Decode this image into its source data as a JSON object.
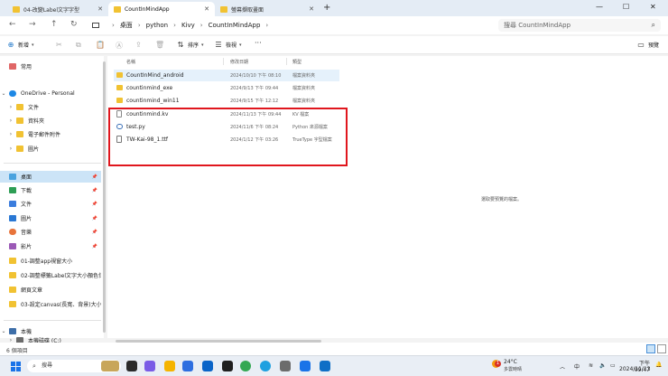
{
  "tabs": [
    {
      "label": "04-改變Label文字字型"
    },
    {
      "label": "CountInMindApp"
    },
    {
      "label": "螢幕擷取畫面"
    }
  ],
  "window_controls": {
    "minimize": "—",
    "maximize": "☐",
    "close": "✕"
  },
  "nav": {
    "back": "←",
    "forward": "→",
    "up": "↑",
    "refresh": "↻"
  },
  "breadcrumb": [
    "桌面",
    "python",
    "Kivy",
    "CountInMindApp"
  ],
  "search": {
    "placeholder": "搜尋 CountInMindApp"
  },
  "toolbar": {
    "new_label": "新增",
    "sort_label": "排序",
    "view_label": "檢視",
    "more_label": "···",
    "preview_label": "預覽"
  },
  "sidebar": {
    "items": [
      {
        "label": "常用",
        "icon": "home-icon"
      },
      {
        "label": "OneDrive - Personal",
        "icon": "cloud-icon"
      },
      {
        "label": "文件",
        "icon": "folder-icon"
      },
      {
        "label": "資料夾",
        "icon": "folder-icon"
      },
      {
        "label": "電子郵件附件",
        "icon": "folder-icon"
      },
      {
        "label": "圖片",
        "icon": "folder-icon"
      },
      {
        "label": "桌面",
        "icon": "desktop-icon"
      },
      {
        "label": "下載",
        "icon": "download-icon"
      },
      {
        "label": "文件",
        "icon": "documents-icon"
      },
      {
        "label": "圖片",
        "icon": "pictures-icon"
      },
      {
        "label": "音樂",
        "icon": "music-icon"
      },
      {
        "label": "影片",
        "icon": "videos-icon"
      },
      {
        "label": "01-調整app視窗大小",
        "icon": "folder-icon"
      },
      {
        "label": "02-調整標籤Label文字大小顏色位",
        "icon": "folder-icon"
      },
      {
        "label": "網頁文章",
        "icon": "folder-icon"
      },
      {
        "label": "03-設定canvas(長寬、背景)大小",
        "icon": "folder-icon"
      },
      {
        "label": "本機",
        "icon": "pc-icon"
      },
      {
        "label": "本機磁碟 (C:)",
        "icon": "disk-icon"
      }
    ]
  },
  "columns": {
    "name": "名稱",
    "date": "修改日期",
    "type": "類型"
  },
  "files": [
    {
      "name": "CountInMind_android",
      "date": "2024/10/10 下午 08:10",
      "type": "檔案資料夾",
      "icon": "folder-icon"
    },
    {
      "name": "countinmind_exe",
      "date": "2024/9/13 下午 09:44",
      "type": "檔案資料夾",
      "icon": "folder-icon"
    },
    {
      "name": "countinmind_win11",
      "date": "2024/9/15 下午 12:12",
      "type": "檔案資料夾",
      "icon": "folder-icon"
    },
    {
      "name": "countinmind.kv",
      "date": "2024/11/13 下午 09:44",
      "type": "KV 檔案",
      "icon": "file-icon"
    },
    {
      "name": "test.py",
      "date": "2024/11/6 下午 08:24",
      "type": "Python 來源檔案",
      "icon": "python-file-icon"
    },
    {
      "name": "TW-Kai-98_1.ttf",
      "date": "2024/1/12 下午 03:26",
      "type": "TrueType 字型檔案",
      "icon": "font-file-icon"
    }
  ],
  "preview_message": "選取要預覽的檔案。",
  "status": {
    "item_count": "6 個項目"
  },
  "taskbar": {
    "search_label": "搜尋",
    "weather_temp": "24°C",
    "weather_desc": "多雲時晴",
    "weather_badge": "1",
    "tray_caret": "︿",
    "ime": "中",
    "clock_time": "下午 09:47",
    "clock_date": "2024/11/13"
  },
  "colors": {
    "accent": "#1a73c8",
    "highlight": "#e5f1fb",
    "selected": "#cce4f7",
    "annotation": "#e0161d",
    "folder": "#f1c232"
  }
}
